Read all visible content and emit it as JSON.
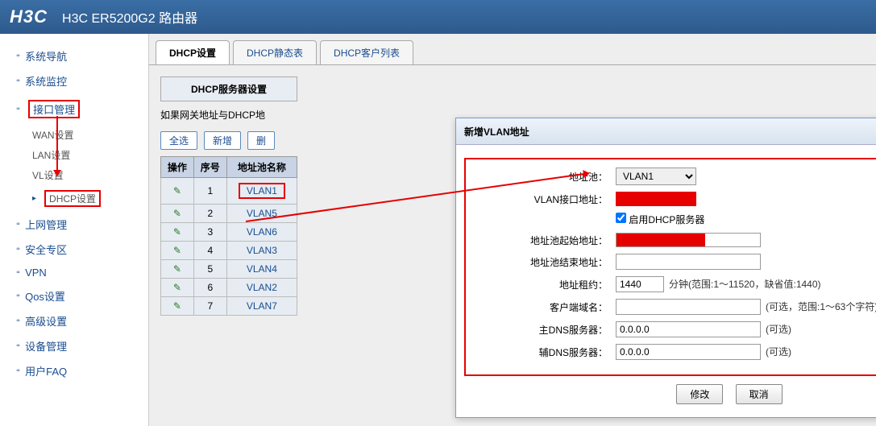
{
  "header": {
    "logo": "H3C",
    "title": "H3C ER5200G2 路由器"
  },
  "nav": {
    "items": [
      {
        "label": "系统导航"
      },
      {
        "label": "系统监控"
      },
      {
        "label": "接口管理",
        "highlight": true,
        "subs": [
          {
            "label": "WAN设置"
          },
          {
            "label": "LAN设置"
          },
          {
            "label": "VL设置"
          },
          {
            "label": "DHCP设置",
            "highlight": true
          }
        ]
      },
      {
        "label": "上网管理"
      },
      {
        "label": "安全专区"
      },
      {
        "label": "VPN"
      },
      {
        "label": "Qos设置"
      },
      {
        "label": "高级设置"
      },
      {
        "label": "设备管理"
      },
      {
        "label": "用户FAQ"
      }
    ]
  },
  "tabs": [
    {
      "label": "DHCP设置",
      "active": true
    },
    {
      "label": "DHCP静态表"
    },
    {
      "label": "DHCP客户列表"
    }
  ],
  "panel": {
    "section_title": "DHCP服务器设置",
    "note": "如果网关地址与DHCP地",
    "buttons": {
      "select_all": "全选",
      "add": "新增",
      "delete": "删"
    },
    "columns": {
      "op": "操作",
      "seq": "序号",
      "name": "地址池名称"
    },
    "rows": [
      {
        "seq": 1,
        "name": "VLAN1",
        "highlight": true
      },
      {
        "seq": 2,
        "name": "VLAN5"
      },
      {
        "seq": 3,
        "name": "VLAN6"
      },
      {
        "seq": 4,
        "name": "VLAN3"
      },
      {
        "seq": 5,
        "name": "VLAN4"
      },
      {
        "seq": 6,
        "name": "VLAN2"
      },
      {
        "seq": 7,
        "name": "VLAN7"
      }
    ]
  },
  "dialog": {
    "title": "新增VLAN地址",
    "labels": {
      "pool": "地址池：",
      "vlan_ip": "VLAN接口地址：",
      "enable": "启用DHCP服务器",
      "start": "地址池起始地址：",
      "end": "地址池结束地址：",
      "lease": "地址租约：",
      "domain": "客户端域名：",
      "dns1": "主DNS服务器：",
      "dns2": "辅DNS服务器："
    },
    "values": {
      "pool_selected": "VLAN1",
      "lease": "1440",
      "dns1": "0.0.0.0",
      "dns2": "0.0.0.0"
    },
    "hints": {
      "lease": "分钟(范围:1～11520，缺省值:1440)",
      "domain": "(可选，范围:1～63个字符)",
      "dns": "(可选)"
    },
    "buttons": {
      "ok": "修改",
      "cancel": "取消"
    }
  }
}
